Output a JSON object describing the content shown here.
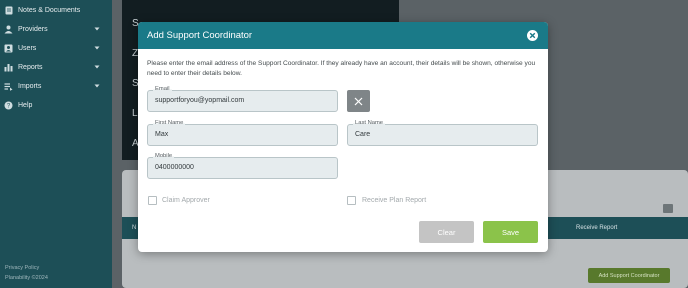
{
  "sidebar": {
    "items": [
      {
        "label": "Notes & Documents",
        "icon": "document-icon",
        "expandable": false
      },
      {
        "label": "Providers",
        "icon": "providers-icon",
        "expandable": true
      },
      {
        "label": "Users",
        "icon": "users-icon",
        "expandable": true
      },
      {
        "label": "Reports",
        "icon": "reports-icon",
        "expandable": true
      },
      {
        "label": "Imports",
        "icon": "imports-icon",
        "expandable": true
      },
      {
        "label": "Help",
        "icon": "help-icon",
        "expandable": false
      }
    ],
    "footer": {
      "privacy": "Privacy Policy",
      "copyright": "Planability ©2024"
    }
  },
  "background": {
    "letters": [
      "S",
      "Z",
      "S",
      "L",
      "A"
    ],
    "table_header": {
      "partial_left": "N",
      "receive_report": "Receive Report"
    },
    "add_button": "Add Support Coordinator"
  },
  "modal": {
    "title": "Add Support Coordinator",
    "intro": "Please enter the email address of the Support Coordinator. If they already have an account, their details will be shown, otherwise you need to enter their details below.",
    "email": {
      "label": "Email",
      "value": "supportforyou@yopmail.com"
    },
    "first_name": {
      "label": "First Name",
      "value": "Max"
    },
    "last_name": {
      "label": "Last Name",
      "value": "Care"
    },
    "mobile": {
      "label": "Mobile",
      "value": "0400000000"
    },
    "claim_approver": {
      "label": "Claim Approver",
      "checked": false
    },
    "receive_plan_report": {
      "label": "Receive Plan Report",
      "checked": false
    },
    "clear_label": "Clear",
    "save_label": "Save"
  },
  "colors": {
    "sidebar": "#1d4f57",
    "header": "#1a7a88",
    "save": "#8bc34a",
    "clear": "#c4c4c4"
  }
}
